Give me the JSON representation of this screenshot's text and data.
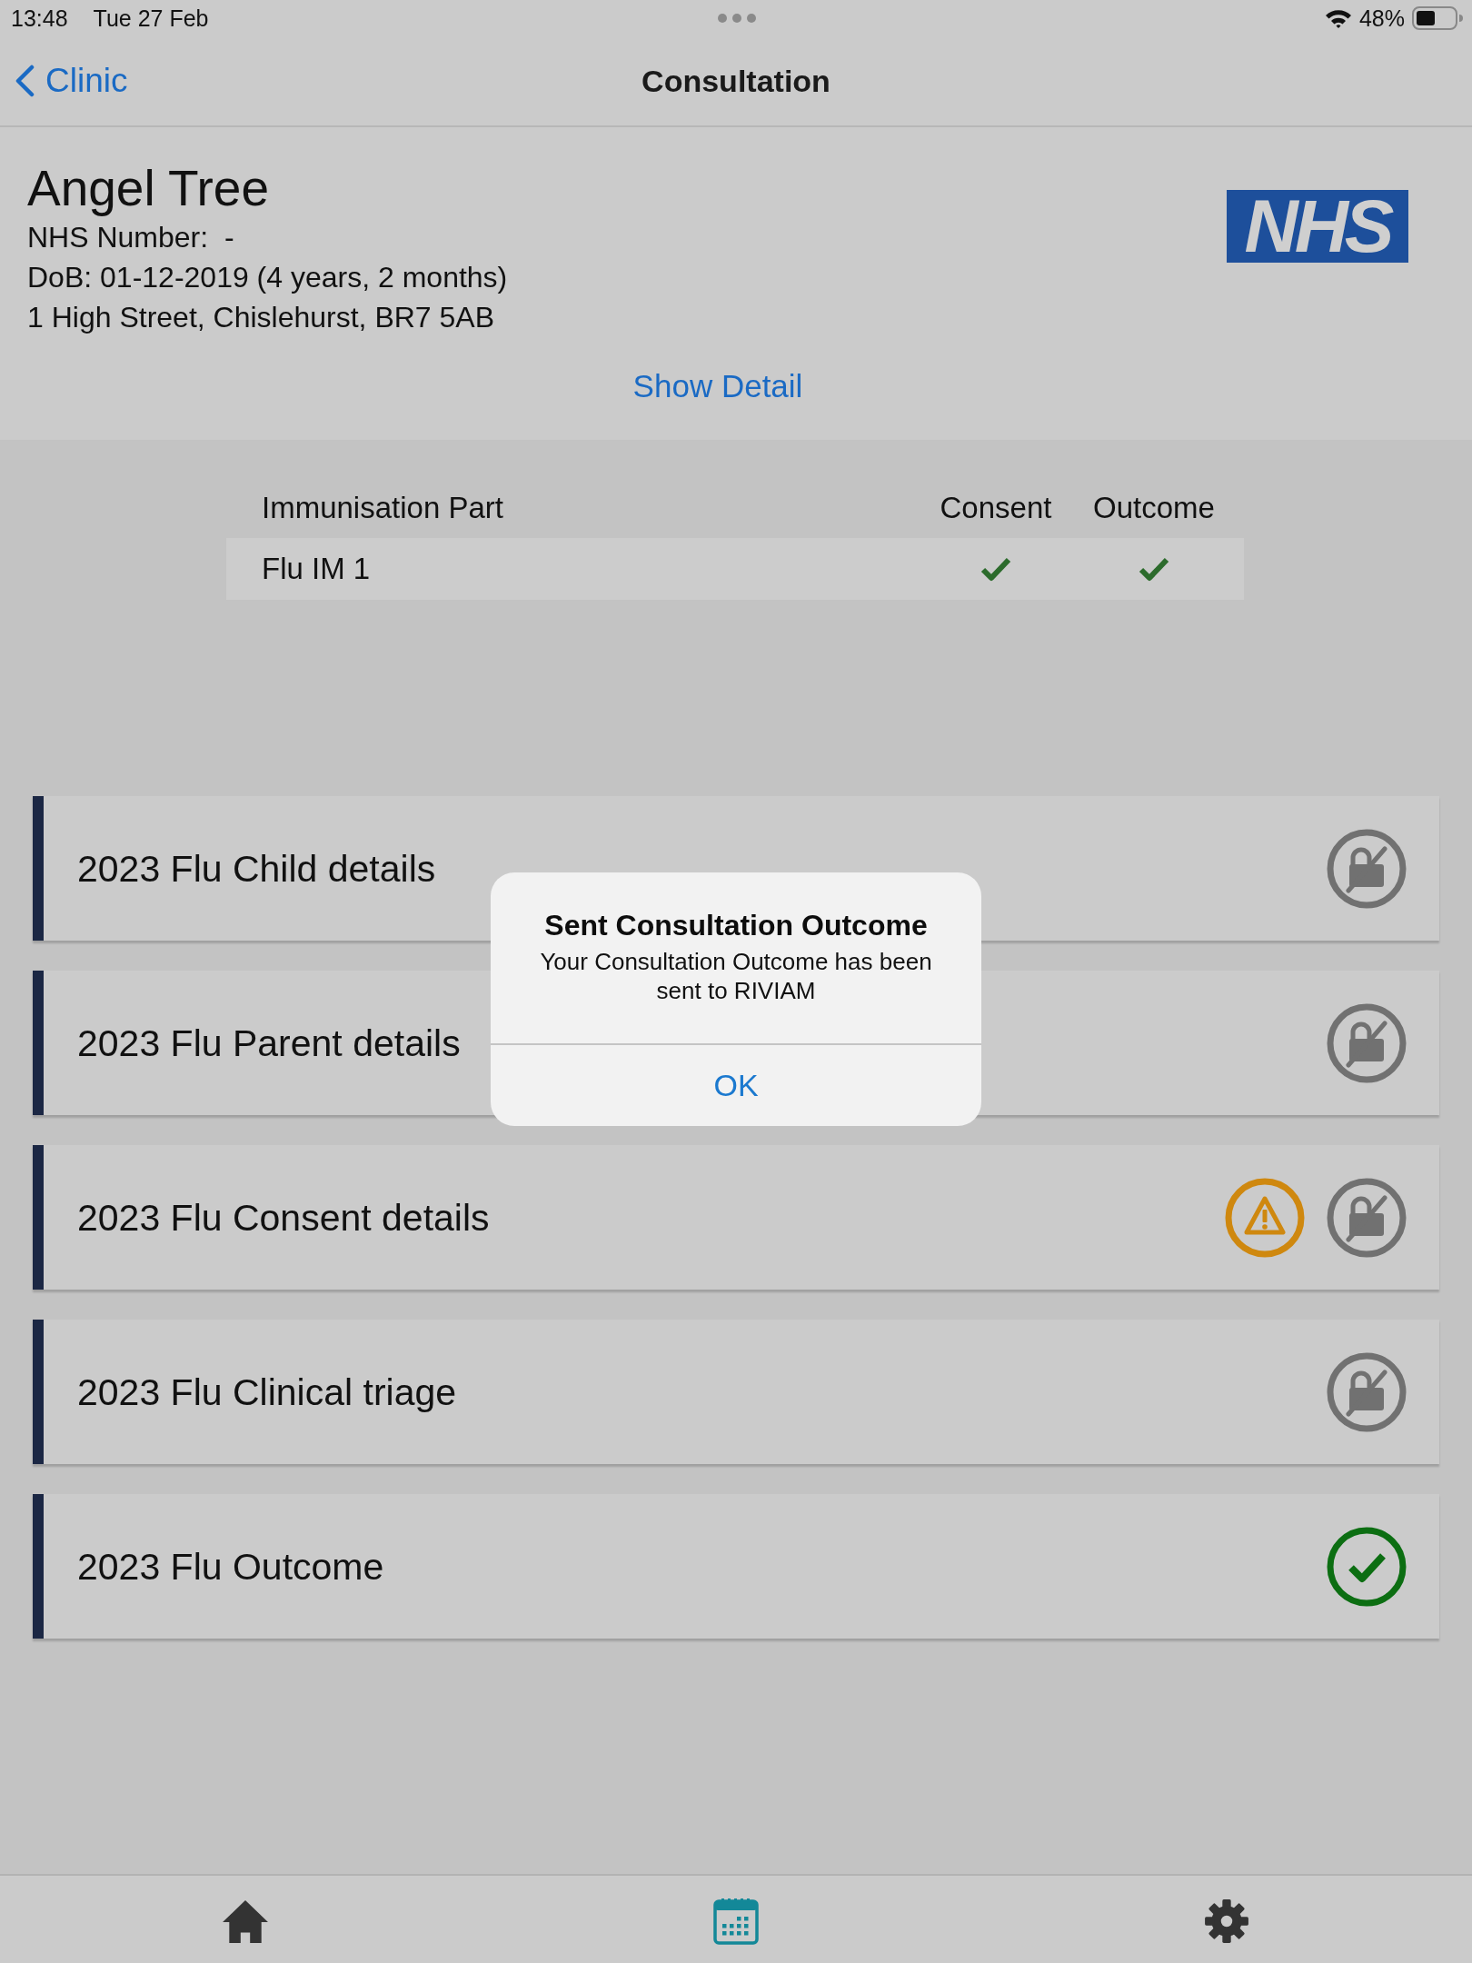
{
  "status_bar": {
    "time": "13:48",
    "date": "Tue 27 Feb",
    "battery": "48%"
  },
  "nav_bar": {
    "back_label": "Clinic",
    "title": "Consultation"
  },
  "patient": {
    "name": "Angel Tree",
    "nhs_number": "NHS Number:  -",
    "dob": "DoB: 01-12-2019 (4 years, 2 months)",
    "address": "1 High Street, Chislehurst, BR7 5AB",
    "logo": "NHS",
    "show_detail": "Show Detail"
  },
  "immunisation_table": {
    "columns": [
      "Immunisation Part",
      "Consent",
      "Outcome"
    ],
    "rows": [
      {
        "part": "Flu IM 1",
        "consent": true,
        "outcome": true
      }
    ]
  },
  "sections": [
    {
      "title": "2023 Flu Child details",
      "warning": false,
      "kind": "locked"
    },
    {
      "title": "2023 Flu Parent details",
      "warning": false,
      "kind": "locked"
    },
    {
      "title": "2023 Flu Consent details",
      "warning": true,
      "kind": "locked"
    },
    {
      "title": "2023 Flu Clinical triage",
      "warning": false,
      "kind": "locked"
    },
    {
      "title": "2023 Flu Outcome",
      "warning": false,
      "kind": "complete"
    }
  ],
  "alert": {
    "title": "Sent Consultation Outcome",
    "message": "Your Consultation Outcome has been sent to RIVIAM",
    "button": "OK"
  },
  "tab_bar": {
    "items": [
      {
        "kind": "home",
        "selected": false
      },
      {
        "kind": "calendar",
        "selected": true
      },
      {
        "kind": "settings",
        "selected": false
      }
    ]
  }
}
